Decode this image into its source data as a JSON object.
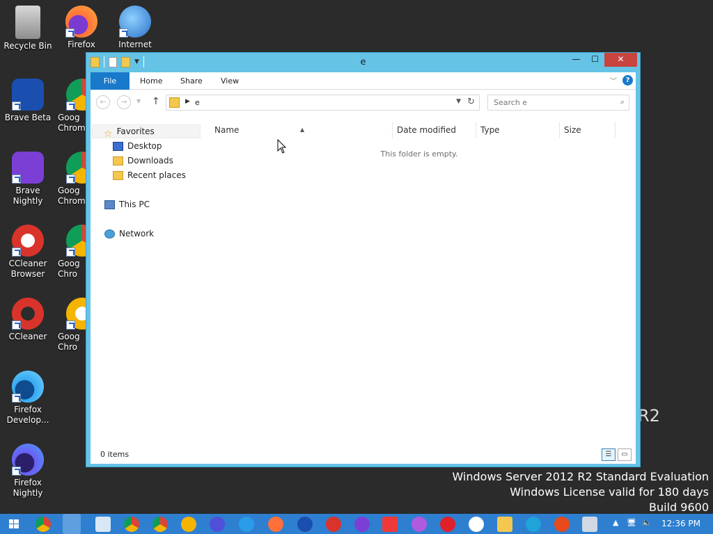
{
  "desktop": {
    "icons": [
      {
        "label": "Recycle Bin"
      },
      {
        "label": "Firefox"
      },
      {
        "label": "Internet"
      },
      {
        "label": "Brave Beta"
      },
      {
        "label": "Goog Chrome"
      },
      {
        "label": "Brave Nightly"
      },
      {
        "label": "Goog Chrom"
      },
      {
        "label": "CCleaner Browser"
      },
      {
        "label": "Goog Chro"
      },
      {
        "label": "CCleaner"
      },
      {
        "label": "Goog Chro"
      },
      {
        "label": "Firefox Develop..."
      },
      {
        "label": "Firefox Nightly"
      }
    ],
    "watermark": {
      "line1": "Windows Server 2012 R2 Standard Evaluation",
      "line2": "Windows License valid for 180 days",
      "line3": "Build 9600"
    },
    "bg_fragment": "R2"
  },
  "explorer": {
    "title": "e",
    "ribbon": {
      "tabs": [
        {
          "label": "File"
        },
        {
          "label": "Home"
        },
        {
          "label": "Share"
        },
        {
          "label": "View"
        }
      ],
      "help": "?"
    },
    "address": {
      "path": "e"
    },
    "search": {
      "placeholder": "Search e"
    },
    "nav": {
      "favorites": "Favorites",
      "desktop": "Desktop",
      "downloads": "Downloads",
      "recent": "Recent places",
      "this_pc": "This PC",
      "network": "Network"
    },
    "columns": [
      {
        "label": "Name"
      },
      {
        "label": "Date modified"
      },
      {
        "label": "Type"
      },
      {
        "label": "Size"
      }
    ],
    "empty_message": "This folder is empty.",
    "status": {
      "items": "0 items"
    }
  },
  "taskbar": {
    "clock": "12:36 PM"
  },
  "colors": {
    "window_frame": "#65c3e6",
    "ribbon_file": "#1979ca",
    "taskbar": "#2e7fd0",
    "close_button": "#c7443f"
  }
}
